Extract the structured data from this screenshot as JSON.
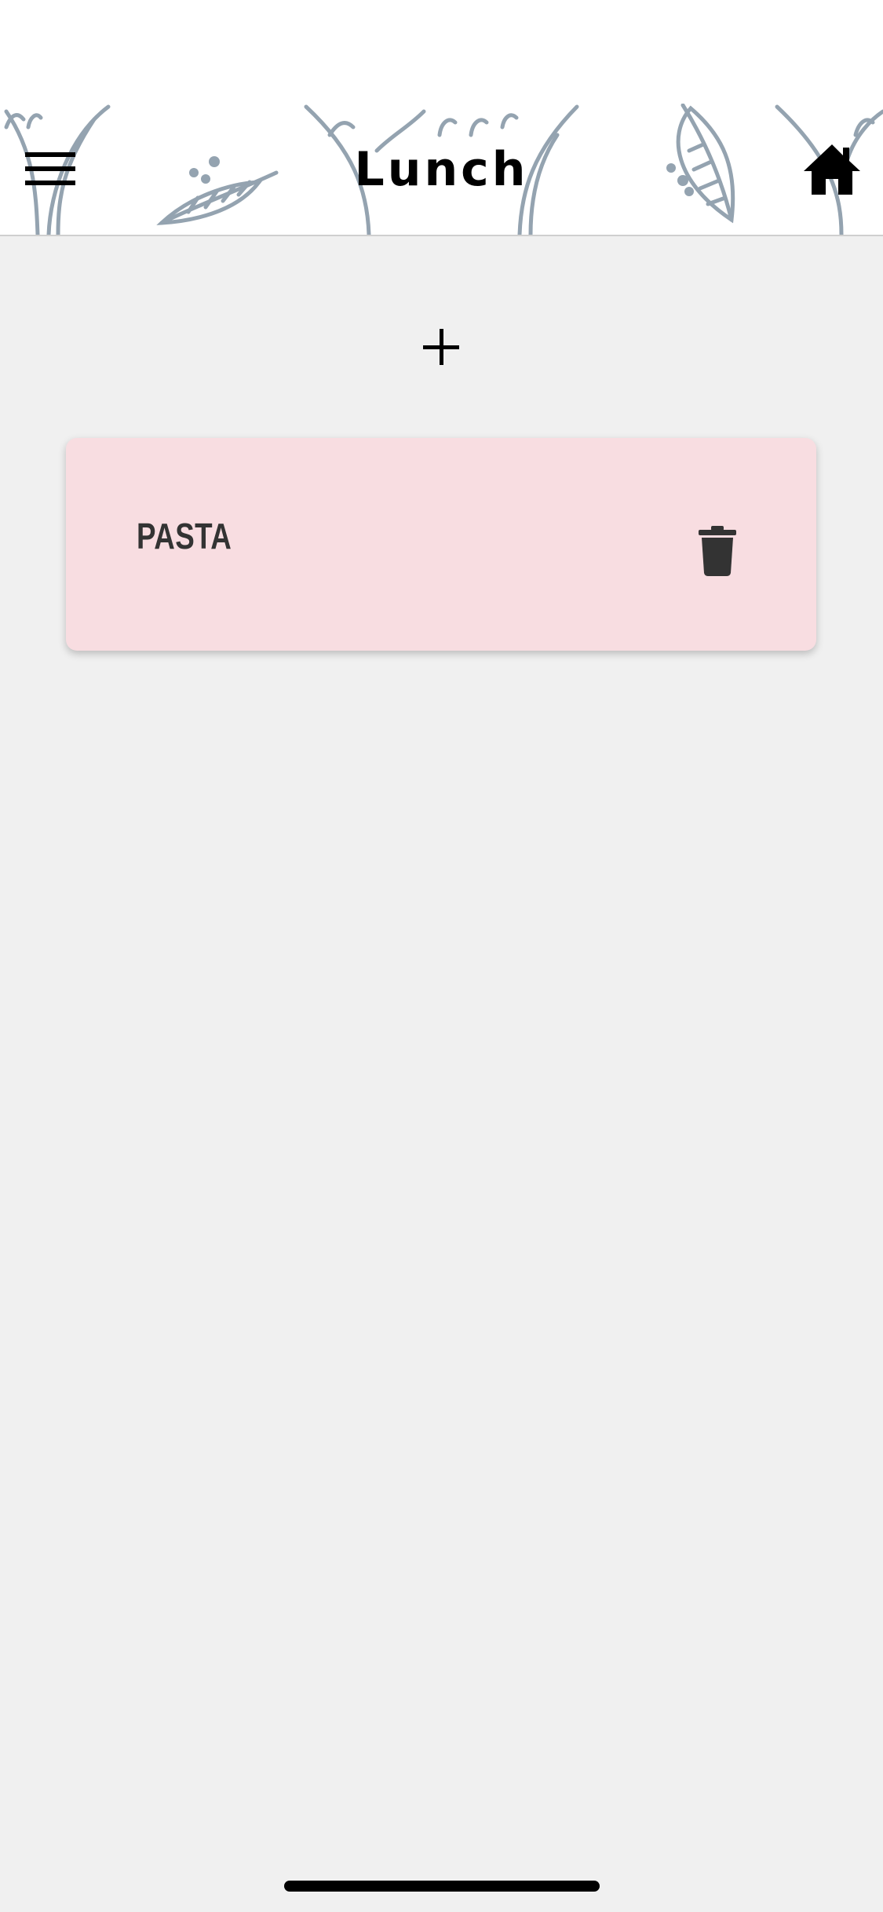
{
  "header": {
    "title": "Lunch",
    "menu_icon": "hamburger-menu-icon",
    "home_icon": "home-icon"
  },
  "toolbar": {
    "add_icon": "plus-icon"
  },
  "items": [
    {
      "name": "PASTA",
      "delete_icon": "trash-icon"
    }
  ],
  "colors": {
    "background": "#f0f0f0",
    "header_background": "#ffffff",
    "card_background": "#f8dde1",
    "decoration": "#94a3b0",
    "text": "#333333"
  }
}
